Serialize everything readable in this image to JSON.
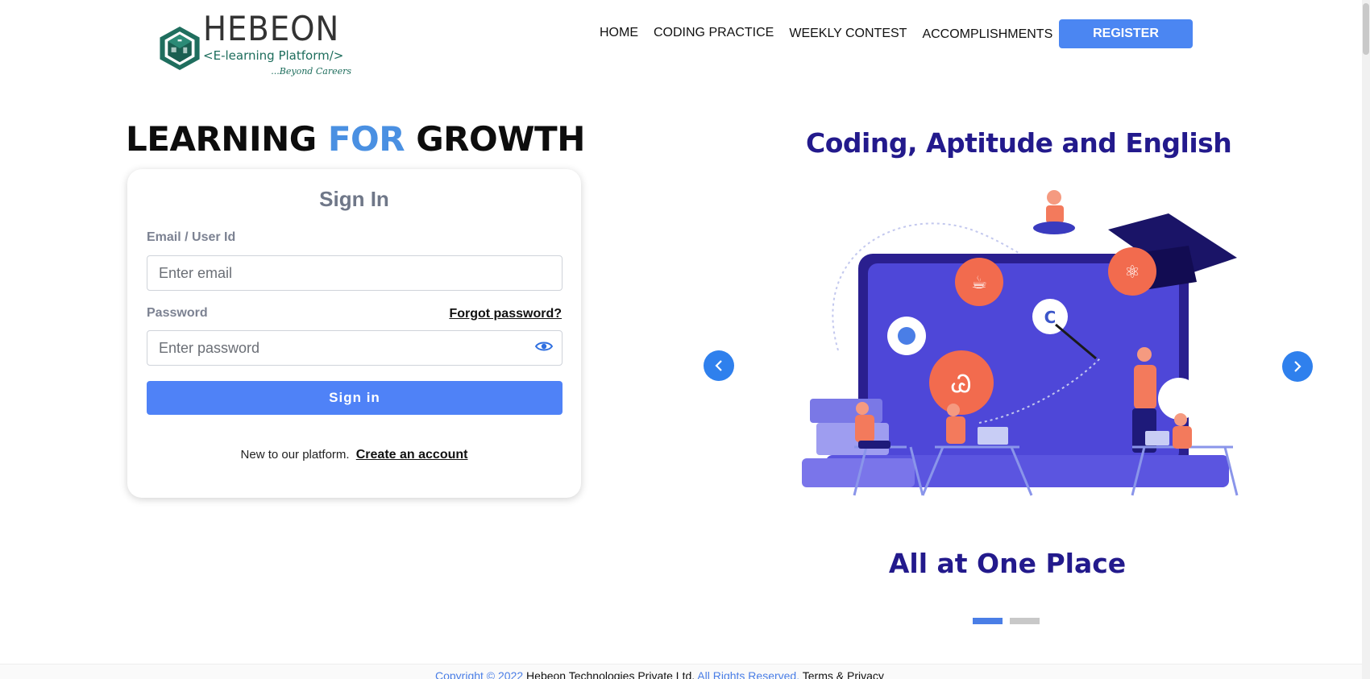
{
  "brand": {
    "name": "HEBEON",
    "subtitle": "<E-learning Platform/>",
    "tagline": "...Beyond Careers",
    "primary_color": "#1d6d5c"
  },
  "nav": {
    "items": [
      "HOME",
      "CODING PRACTICE",
      "WEEKLY CONTEST",
      "ACCOMPLISHMENTS"
    ],
    "register_label": "REGISTER"
  },
  "hero": {
    "headline_part1": "LEARNING",
    "headline_part2": "FOR",
    "headline_part3": "GROWTH"
  },
  "signin": {
    "title": "Sign In",
    "email_label": "Email / User Id",
    "email_placeholder": "Enter email",
    "email_value": "",
    "password_label": "Password",
    "forgot_label": "Forgot password?",
    "password_placeholder": "Enter password",
    "password_value": "",
    "eye_icon": "eye-icon",
    "submit_label": "Sign in",
    "signup_prompt": "New to our platform.",
    "signup_link": "Create an account"
  },
  "carousel": {
    "top_text": "Coding, Aptitude and English",
    "bottom_text": "All at One Place",
    "prev_icon": "chevron-left-icon",
    "next_icon": "chevron-right-icon",
    "slide_count": 2,
    "active_index": 0
  },
  "footer": {
    "copyright": "Copyright © 2022",
    "company": "Hebeon Technologies Private Ltd.",
    "rights": "All Rights Reserved.",
    "terms": "Terms & Privacy"
  },
  "colors": {
    "accent_blue": "#4f82f7",
    "headline_blue": "#4a90e2",
    "navy": "#231a8c"
  }
}
